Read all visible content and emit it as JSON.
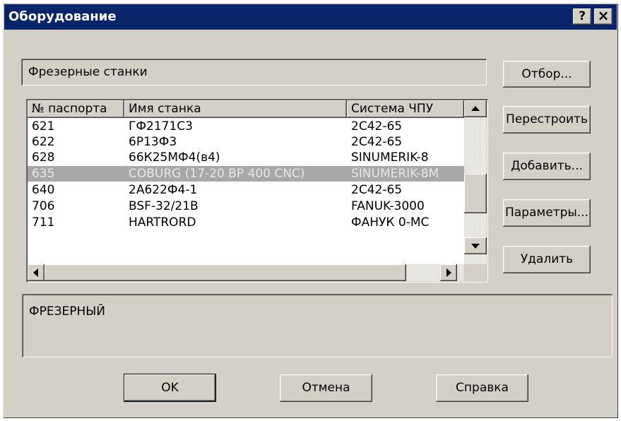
{
  "window": {
    "title": "Оборудование",
    "help_label": "?",
    "close_label": "×"
  },
  "category": {
    "value": "Фрезерные станки"
  },
  "side_buttons": {
    "filter": "Отбор...",
    "rebuild": "Перестроить",
    "add": "Добавить...",
    "params": "Параметры...",
    "delete": "Удалить"
  },
  "table": {
    "columns": [
      "№ паспорта",
      "Имя станка",
      "Система ЧПУ"
    ],
    "rows": [
      [
        "621",
        "ГФ2171С3",
        "2С42-65"
      ],
      [
        "622",
        "6Р13Ф3",
        "2С42-65"
      ],
      [
        "628",
        "66К25МФ4(в4)",
        "SINUMERIK-8"
      ],
      [
        "635",
        "COBURG (17-20 BP 400 CNC)",
        "SINUMERIK-8M"
      ],
      [
        "640",
        "2А622Ф4-1",
        "2С42-65"
      ],
      [
        "706",
        "BSF-32/21B",
        "FANUK-3000"
      ],
      [
        "711",
        "HARTRORD",
        "ФАНУК 0-МС"
      ]
    ],
    "selected_index": 3
  },
  "description": {
    "value": "ФРЕЗЕРНЫЙ"
  },
  "bottom_buttons": {
    "ok": "OK",
    "cancel": "Отмена",
    "help": "Справка"
  }
}
